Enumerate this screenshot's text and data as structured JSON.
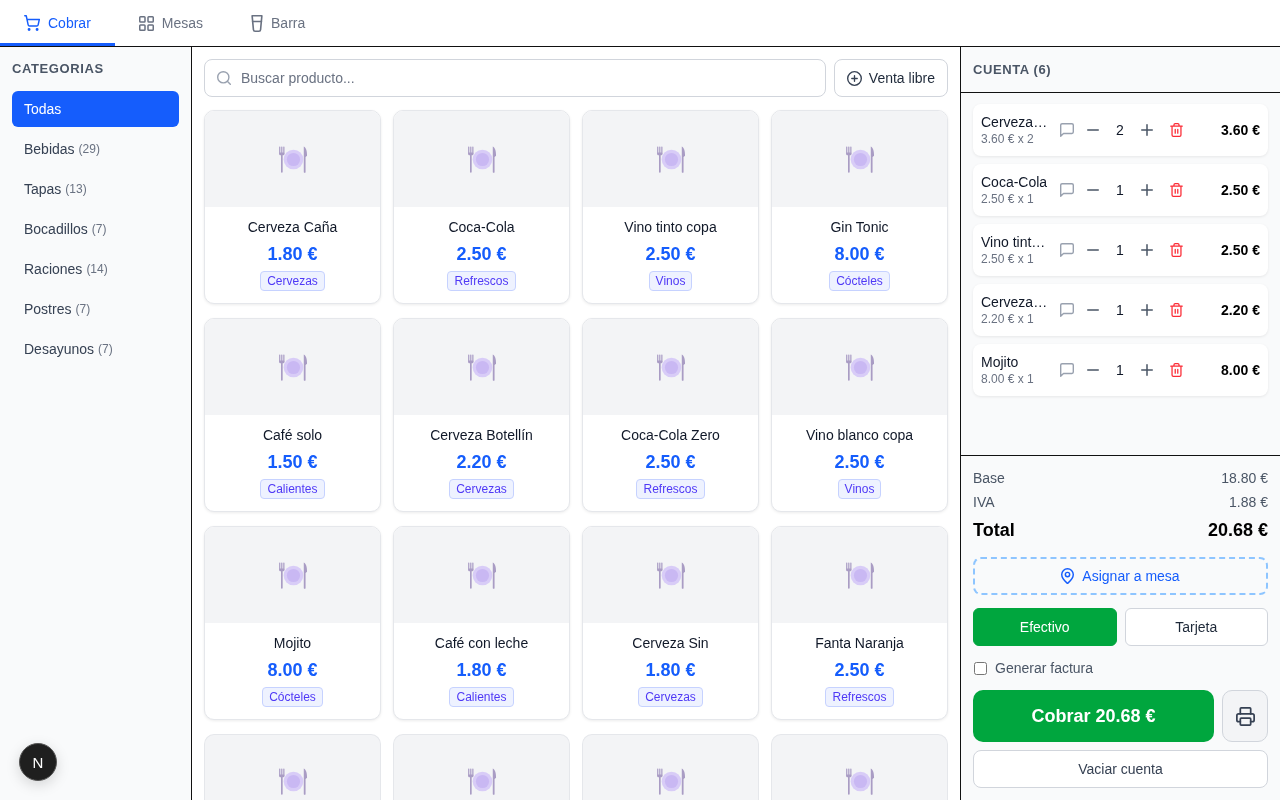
{
  "tabs": [
    {
      "label": "Cobrar",
      "selected": true
    },
    {
      "label": "Mesas",
      "selected": false
    },
    {
      "label": "Barra",
      "selected": false
    }
  ],
  "sidebar": {
    "title": "CATEGORIAS",
    "categories": [
      {
        "label": "Todas",
        "selected": true
      },
      {
        "label": "Bebidas",
        "count": "(29)",
        "selected": false
      },
      {
        "label": "Tapas",
        "count": "(13)",
        "selected": false
      },
      {
        "label": "Bocadillos",
        "count": "(7)",
        "selected": false
      },
      {
        "label": "Raciones",
        "count": "(14)",
        "selected": false
      },
      {
        "label": "Postres",
        "count": "(7)",
        "selected": false
      },
      {
        "label": "Desayunos",
        "count": "(7)",
        "selected": false
      }
    ]
  },
  "catalog": {
    "search": {
      "placeholder": "Buscar producto..."
    },
    "free_sale_button": "Venta libre",
    "products": [
      {
        "kind": "product",
        "name": "Cerveza Caña",
        "price": "1.80 €",
        "category": "Cervezas"
      },
      {
        "kind": "product",
        "name": "Coca-Cola",
        "price": "2.50 €",
        "category": "Refrescos"
      },
      {
        "kind": "product",
        "name": "Vino tinto copa",
        "price": "2.50 €",
        "category": "Vinos"
      },
      {
        "kind": "product",
        "name": "Gin Tonic",
        "price": "8.00 €",
        "category": "Cócteles"
      },
      {
        "kind": "product",
        "name": "Café solo",
        "price": "1.50 €",
        "category": "Calientes"
      },
      {
        "kind": "product",
        "name": "Cerveza Botellín",
        "price": "2.20 €",
        "category": "Cervezas"
      },
      {
        "kind": "product",
        "name": "Coca-Cola Zero",
        "price": "2.50 €",
        "category": "Refrescos"
      },
      {
        "kind": "product",
        "name": "Vino blanco copa",
        "price": "2.50 €",
        "category": "Vinos"
      },
      {
        "kind": "product",
        "name": "Mojito",
        "price": "8.00 €",
        "category": "Cócteles"
      },
      {
        "kind": "product",
        "name": "Café con leche",
        "price": "1.80 €",
        "category": "Calientes"
      },
      {
        "kind": "product",
        "name": "Cerveza Sin",
        "price": "1.80 €",
        "category": "Cervezas"
      },
      {
        "kind": "product",
        "name": "Fanta Naranja",
        "price": "2.50 €",
        "category": "Refrescos"
      },
      {
        "kind": "clipped"
      },
      {
        "kind": "clipped"
      },
      {
        "kind": "clipped"
      },
      {
        "kind": "clipped"
      }
    ]
  },
  "account": {
    "title": "CUENTA (6)",
    "items": [
      {
        "name": "Cerveza…",
        "unit_price": "3.60 € x 2",
        "quantity": "2",
        "total": "3.60 €"
      },
      {
        "name": "Coca-Cola",
        "unit_price": "2.50 € x 1",
        "quantity": "1",
        "total": "2.50 €"
      },
      {
        "name": "Vino tint…",
        "unit_price": "2.50 € x 1",
        "quantity": "1",
        "total": "2.50 €"
      },
      {
        "name": "Cerveza…",
        "unit_price": "2.20 € x 1",
        "quantity": "1",
        "total": "2.20 €"
      },
      {
        "name": "Mojito",
        "unit_price": "8.00 € x 1",
        "quantity": "1",
        "total": "8.00 €"
      }
    ],
    "summary": [
      {
        "label": "Base",
        "value": "18.80 €"
      },
      {
        "label": "IVA",
        "value": "1.88 €"
      }
    ],
    "total": {
      "label": "Total",
      "value": "20.68 €"
    },
    "assign_table_button": "Asignar a mesa",
    "payment_methods": [
      {
        "label": "Efectivo",
        "selected": true
      },
      {
        "label": "Tarjeta",
        "selected": false
      }
    ],
    "invoice_checkbox": {
      "label": "Generar factura",
      "checked": false
    },
    "charge_button": "Cobrar 20.68 €",
    "clear_button": "Vaciar cuenta"
  },
  "dev_indicator": {
    "label": "N"
  }
}
